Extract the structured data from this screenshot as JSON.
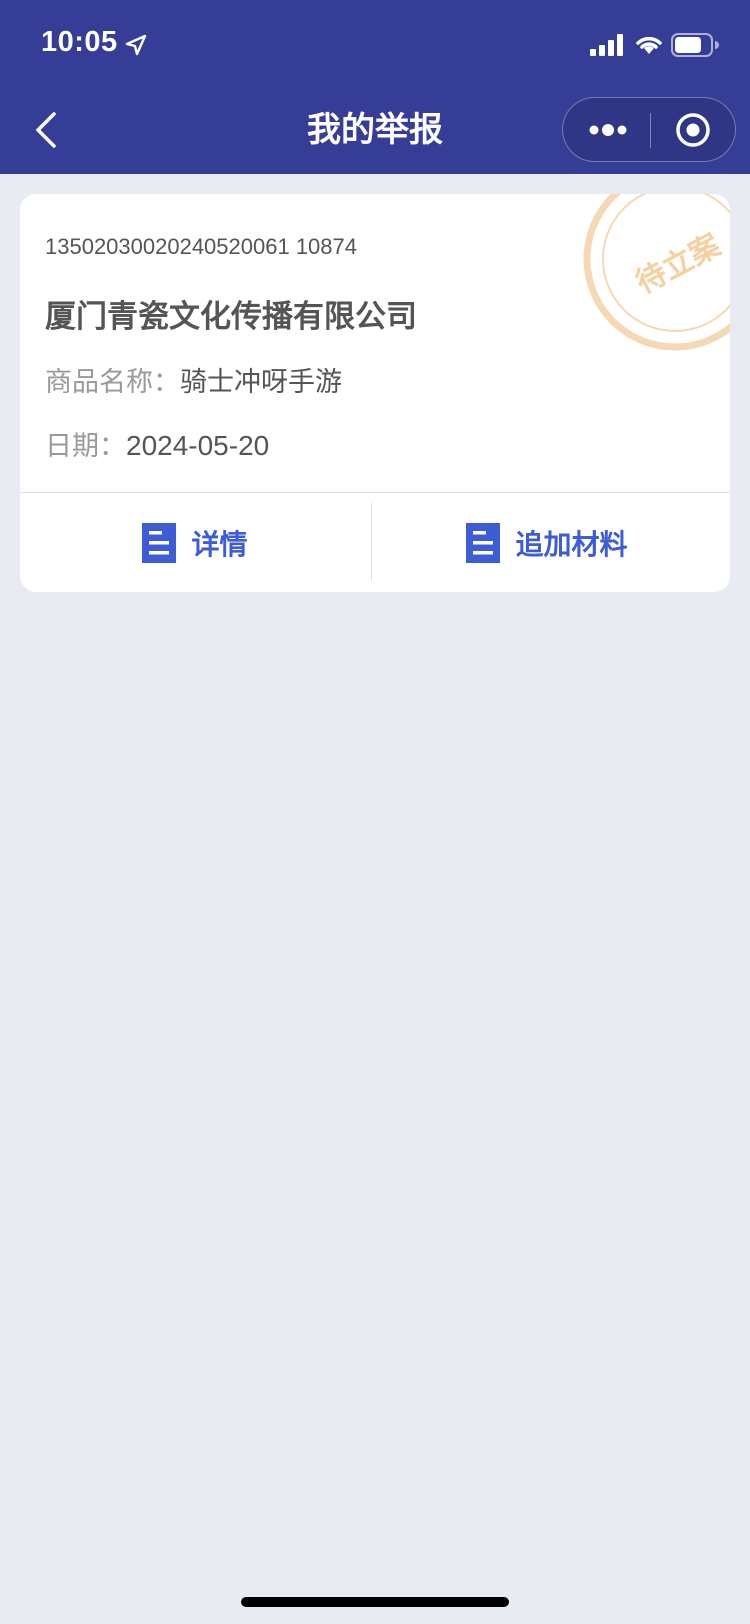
{
  "status_bar": {
    "time": "10:05"
  },
  "nav": {
    "title": "我的举报"
  },
  "report": {
    "number": "13502030020240520061 10874",
    "company": "厦门青瓷文化传播有限公司",
    "product_label": "商品名称：",
    "product_value": "骑士冲呀手游",
    "date_label": "日期：",
    "date_value": "2024-05-20",
    "stamp_text": "待立案"
  },
  "actions": {
    "detail_label": "详情",
    "add_label": "追加材料"
  },
  "colors": {
    "header_bg": "#363d97",
    "page_bg": "#e8ebf1",
    "accent": "#3d5cd6",
    "stamp": "#f5d9b5"
  }
}
